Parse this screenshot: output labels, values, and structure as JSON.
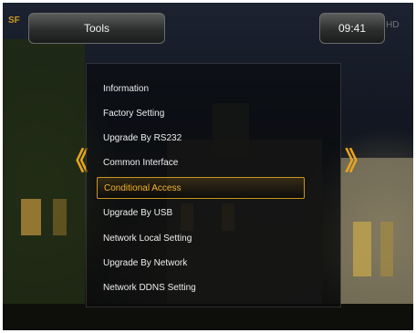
{
  "header": {
    "logo": "SF",
    "title": "Tools",
    "clock": "09:41",
    "brand_mark": "HD"
  },
  "navigation": {
    "left_arrow": "《",
    "right_arrow": "》"
  },
  "menu": {
    "items": [
      {
        "label": "Information",
        "selected": false
      },
      {
        "label": "Factory Setting",
        "selected": false
      },
      {
        "label": "Upgrade By RS232",
        "selected": false
      },
      {
        "label": "Common Interface",
        "selected": false
      },
      {
        "label": "Conditional Access",
        "selected": true
      },
      {
        "label": "Upgrade By USB",
        "selected": false
      },
      {
        "label": "Network Local Setting",
        "selected": false
      },
      {
        "label": "Upgrade By Network",
        "selected": false
      },
      {
        "label": "Network DDNS Setting",
        "selected": false
      }
    ]
  },
  "colors": {
    "accent": "#e8a41f",
    "selected_text": "#f4b42a",
    "text": "#eeeeee"
  }
}
